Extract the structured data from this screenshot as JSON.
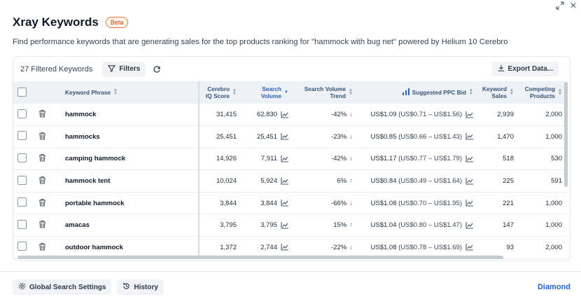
{
  "header": {
    "title": "Xray Keywords",
    "badge": "Beta",
    "subtitle": "Find performance keywords that are generating sales for the top products ranking for \"hammock with bug net\" powered by Helium 10 Cerebro"
  },
  "window": {
    "expand_icon": "expand-icon",
    "close_glyph": "✕"
  },
  "toolbar": {
    "count_label": "27 Filtered Keywords",
    "filters_label": "Filters",
    "export_label": "Export Data..."
  },
  "columns": {
    "keyword_phrase": "Keyword Phrase",
    "cerebro_iq_1": "Cerebro",
    "cerebro_iq_2": "IQ Score",
    "search_volume_1": "Search",
    "search_volume_2": "Volume",
    "sv_trend_1": "Search Volume",
    "sv_trend_2": "Trend",
    "ppc_bid": "Suggested PPC Bid",
    "keyword_sales_1": "Keyword",
    "keyword_sales_2": "Sales",
    "competing_1": "Competing",
    "competing_2": "Products"
  },
  "rows": [
    {
      "keyword": "hammock",
      "iq": "31,415",
      "volume": "62,830",
      "trend": "-42%",
      "dir": "down",
      "bid": "US$1.09",
      "range": "(US$0.71 – US$1.56)",
      "sales": "2,939",
      "competing": "2,000"
    },
    {
      "keyword": "hammocks",
      "iq": "25,451",
      "volume": "25,451",
      "trend": "-23%",
      "dir": "down",
      "bid": "US$0.85",
      "range": "(US$0.66 – US$1.43)",
      "sales": "1,470",
      "competing": "1,000"
    },
    {
      "keyword": "camping hammock",
      "iq": "14,926",
      "volume": "7,911",
      "trend": "-42%",
      "dir": "down",
      "bid": "US$1.17",
      "range": "(US$0.77 – US$1.79)",
      "sales": "518",
      "competing": "530"
    },
    {
      "keyword": "hammock tent",
      "iq": "10,024",
      "volume": "5,924",
      "trend": "6%",
      "dir": "up",
      "bid": "US$0.84",
      "range": "(US$0.49 – US$1.64)",
      "sales": "225",
      "competing": "591"
    },
    {
      "keyword": "portable hammock",
      "iq": "3,844",
      "volume": "3,844",
      "trend": "-66%",
      "dir": "down",
      "bid": "US$1.08",
      "range": "(US$0.70 – US$1.95)",
      "sales": "221",
      "competing": "1,000"
    },
    {
      "keyword": "amacas",
      "iq": "3,795",
      "volume": "3,795",
      "trend": "15%",
      "dir": "up",
      "bid": "US$1.04",
      "range": "(US$0.80 – US$1.47)",
      "sales": "147",
      "competing": "1,000"
    },
    {
      "keyword": "outdoor hammock",
      "iq": "1,372",
      "volume": "2,744",
      "trend": "-22%",
      "dir": "down",
      "bid": "US$1.08",
      "range": "(US$0.78 – US$1.69)",
      "sales": "93",
      "competing": "2,000"
    }
  ],
  "footer": {
    "global_settings_label": "Global Search Settings",
    "history_label": "History",
    "plan_label": "Diamond"
  },
  "colors": {
    "accent_blue": "#2563c9",
    "trend_down": "#e04b3c",
    "trend_up": "#2fa86a",
    "beta_border": "#e8763a"
  }
}
